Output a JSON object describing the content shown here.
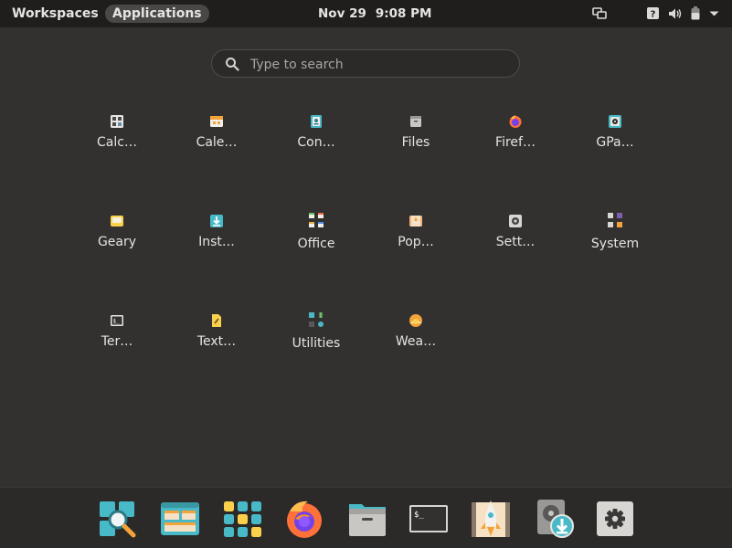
{
  "topbar": {
    "workspaces_label": "Workspaces",
    "applications_label": "Applications",
    "date": "Nov 29",
    "time": "9:08 PM"
  },
  "search": {
    "placeholder": "Type to search"
  },
  "apps": [
    {
      "label": "Calc…"
    },
    {
      "label": "Cale…"
    },
    {
      "label": "Con…"
    },
    {
      "label": "Files"
    },
    {
      "label": "Firef…"
    },
    {
      "label": "GPa…"
    },
    {
      "label": "Geary"
    },
    {
      "label": "Inst…"
    },
    {
      "label": "Office"
    },
    {
      "label": "Pop…"
    },
    {
      "label": "Sett…"
    },
    {
      "label": "System"
    },
    {
      "label": "Ter…"
    },
    {
      "label": "Text…"
    },
    {
      "label": "Utilities"
    },
    {
      "label": "Wea…"
    }
  ],
  "dock": [
    {
      "icon": "launcher-icon"
    },
    {
      "icon": "workspaces-icon"
    },
    {
      "icon": "applications-icon"
    },
    {
      "icon": "firefox-icon"
    },
    {
      "icon": "files-icon"
    },
    {
      "icon": "terminal-icon"
    },
    {
      "icon": "pop-shop-icon"
    },
    {
      "icon": "installer-icon"
    },
    {
      "icon": "settings-icon"
    }
  ]
}
